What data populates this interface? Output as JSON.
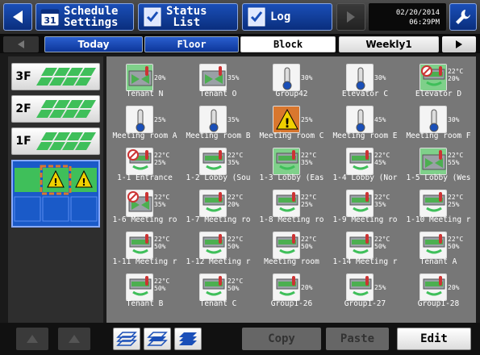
{
  "topbar": {
    "schedule_label": "Schedule\nSettings",
    "status_label": "Status\n List",
    "log_label": "Log",
    "date": "02/20/2014",
    "time": "06:29PM",
    "icons": {
      "back": "left-arrow-icon",
      "schedule": "calendar-31-icon",
      "status": "checklist-icon",
      "log": "log-checklist-icon",
      "forward": "right-arrow-icon",
      "settings": "wrench-icon"
    }
  },
  "tabs": {
    "today": "Today",
    "floor": "Floor",
    "block": "Block",
    "weekly": "Weekly1",
    "selected": "Block"
  },
  "floors": [
    {
      "label": "3F"
    },
    {
      "label": "2F"
    },
    {
      "label": "1F"
    }
  ],
  "colors": {
    "accent_blue": "#1a4fb8",
    "cool_green": "#3fbf5a",
    "warning_orange": "#d9772e",
    "grid_bg": "#777777"
  },
  "devices": [
    {
      "name": "Tenant N",
      "temp": "",
      "value": "20%",
      "type": "fan",
      "bg": "green"
    },
    {
      "name": "Tenant O",
      "temp": "",
      "value": "35%",
      "type": "fan",
      "bg": "white"
    },
    {
      "name": "Group42",
      "temp": "",
      "value": "30%",
      "type": "thermo",
      "bg": "white"
    },
    {
      "name": "Elevator C",
      "temp": "",
      "value": "30%",
      "type": "thermo",
      "bg": "white"
    },
    {
      "name": "Elevator D",
      "temp": "22°C",
      "value": "20%",
      "type": "ac-alert",
      "bg": "green"
    },
    {
      "name": "Meeting room A",
      "temp": "",
      "value": "25%",
      "type": "thermo",
      "bg": "white"
    },
    {
      "name": "Meeting room B",
      "temp": "",
      "value": "35%",
      "type": "thermo",
      "bg": "white"
    },
    {
      "name": "Meeting room C",
      "temp": "",
      "value": "25%",
      "type": "warn",
      "bg": "orange"
    },
    {
      "name": "Meeting room E",
      "temp": "",
      "value": "45%",
      "type": "thermo",
      "bg": "white"
    },
    {
      "name": "Meeting room F",
      "temp": "",
      "value": "30%",
      "type": "thermo",
      "bg": "white"
    },
    {
      "name": "1-1 Entrance",
      "temp": "22°C",
      "value": "25%",
      "type": "ac-alert",
      "bg": "white"
    },
    {
      "name": "1-2 Lobby (Sou",
      "temp": "22°C",
      "value": "35%",
      "type": "ac",
      "bg": "white"
    },
    {
      "name": "1-3 Lobby (Eas",
      "temp": "22°C",
      "value": "35%",
      "type": "ac",
      "bg": "green"
    },
    {
      "name": "1-4 Lobby (Nor",
      "temp": "22°C",
      "value": "45%",
      "type": "ac",
      "bg": "white"
    },
    {
      "name": "1-5 Lobby (Wes",
      "temp": "22°C",
      "value": "55%",
      "type": "fan",
      "bg": "green"
    },
    {
      "name": "1-6 Meeting ro",
      "temp": "22°C",
      "value": "35%",
      "type": "fan-alert",
      "bg": "white"
    },
    {
      "name": "1-7 Meeting ro",
      "temp": "22°C",
      "value": "20%",
      "type": "ac",
      "bg": "white"
    },
    {
      "name": "1-8 Meeting ro",
      "temp": "22°C",
      "value": "25%",
      "type": "ac",
      "bg": "white"
    },
    {
      "name": "1-9 Meeting ro",
      "temp": "22°C",
      "value": "35%",
      "type": "ac",
      "bg": "white"
    },
    {
      "name": "1-10 Meeting r",
      "temp": "22°C",
      "value": "25%",
      "type": "ac",
      "bg": "white"
    },
    {
      "name": "1-11 Meeting r",
      "temp": "22°C",
      "value": "50%",
      "type": "ac",
      "bg": "white"
    },
    {
      "name": "1-12 Meeting r",
      "temp": "22°C",
      "value": "50%",
      "type": "ac",
      "bg": "white"
    },
    {
      "name": "Meeting room",
      "temp": "22°C",
      "value": "50%",
      "type": "ac",
      "bg": "white"
    },
    {
      "name": "1-14 Meeting r",
      "temp": "22°C",
      "value": "50%",
      "type": "ac",
      "bg": "white"
    },
    {
      "name": "Tenant A",
      "temp": "22°C",
      "value": "50%",
      "type": "ac",
      "bg": "white"
    },
    {
      "name": "Tenant B",
      "temp": "22°C",
      "value": "50%",
      "type": "ac",
      "bg": "white"
    },
    {
      "name": "Tenant C",
      "temp": "22°C",
      "value": "50%",
      "type": "ac",
      "bg": "white"
    },
    {
      "name": "Group1-26",
      "temp": "",
      "value": "20%",
      "type": "ac",
      "bg": "white"
    },
    {
      "name": "Group1-27",
      "temp": "",
      "value": "25%",
      "type": "ac",
      "bg": "white"
    },
    {
      "name": "Group1-28",
      "temp": "",
      "value": "20%",
      "type": "ac",
      "bg": "white"
    }
  ],
  "bottombar": {
    "copy_label": "Copy",
    "paste_label": "Paste",
    "edit_label": "Edit",
    "icons": {
      "up": "up-arrow-icon",
      "down": "down-arrow-icon",
      "view1": "layers-outline-icon",
      "view2": "layers-single-icon",
      "view3": "layers-filled-icon"
    }
  }
}
